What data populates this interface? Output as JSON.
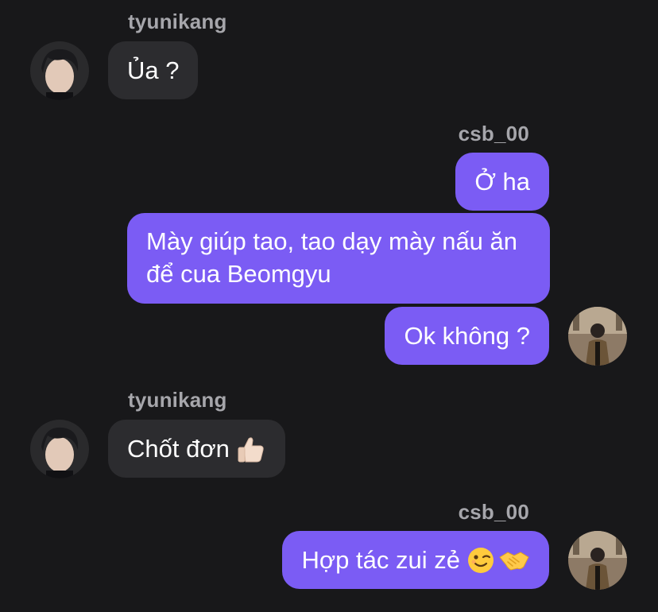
{
  "chat": {
    "messages": [
      {
        "sender": "tyunikang",
        "text": "Ủa ?"
      },
      {
        "sender": "csb_00",
        "text": "Ở ha"
      },
      {
        "text": "Mày giúp tao, tao dạy mày nấu ăn để cua Beomgyu"
      },
      {
        "text": "Ok không ?"
      },
      {
        "sender": "tyunikang",
        "text": "Chốt đơn"
      },
      {
        "sender": "csb_00",
        "text": "Hợp tác zui zẻ"
      }
    ],
    "emojis": {
      "thumbs_up": "thumbs-up-icon",
      "wink": "winking-face-icon",
      "handshake": "handshake-icon"
    }
  },
  "colors": {
    "background": "#18181a",
    "incoming_bubble": "#2c2c2f",
    "outgoing_bubble": "#7b5cf4",
    "sender_name": "#a6a6ab"
  }
}
